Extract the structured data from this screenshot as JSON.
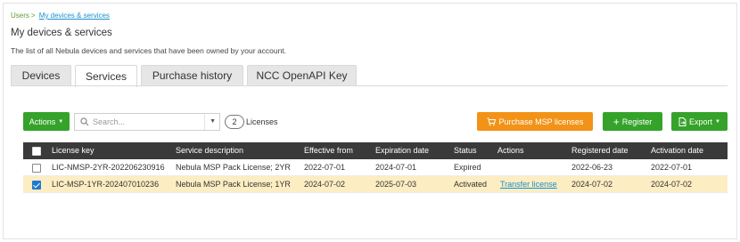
{
  "breadcrumb": {
    "root": "Users",
    "separator": ">",
    "current": "My devices & services"
  },
  "page": {
    "title": "My devices & services",
    "subtitle": "The list of all Nebula devices and services that have been owned by your account."
  },
  "tabs": [
    {
      "label": "Devices",
      "active": false
    },
    {
      "label": "Services",
      "active": true
    },
    {
      "label": "Purchase history",
      "active": false
    },
    {
      "label": "NCC OpenAPI Key",
      "active": false
    }
  ],
  "toolbar": {
    "actions_label": "Actions",
    "search_placeholder": "Search...",
    "count": "2",
    "count_label": "Licenses",
    "purchase_label": "Purchase MSP licenses",
    "register_label": "Register",
    "export_label": "Export"
  },
  "table": {
    "headers": [
      "License key",
      "Service description",
      "Effective from",
      "Expiration date",
      "Status",
      "Actions",
      "Registered date",
      "Activation date"
    ],
    "rows": [
      {
        "checked": false,
        "license_key": "LIC-NMSP-2YR-202206230916",
        "description": "Nebula MSP Pack License; 2YR",
        "effective": "2022-07-01",
        "expiration": "2024-07-01",
        "status": "Expired",
        "action": "",
        "registered": "2022-06-23",
        "activation": "2022-07-01"
      },
      {
        "checked": true,
        "license_key": "LIC-MSP-1YR-202407010236",
        "description": "Nebula MSP Pack License; 1YR",
        "effective": "2024-07-02",
        "expiration": "2025-07-03",
        "status": "Activated",
        "action": "Transfer license",
        "registered": "2024-07-02",
        "activation": "2024-07-02"
      }
    ]
  },
  "colors": {
    "green": "#35a32a",
    "orange": "#f29318",
    "header_bg": "#3a3a3a",
    "selected_row": "#fdedc2",
    "link": "#1a8ecd"
  },
  "icons": {
    "search": "search-icon",
    "cart": "cart-icon",
    "plus": "plus-icon",
    "export": "export-icon"
  }
}
